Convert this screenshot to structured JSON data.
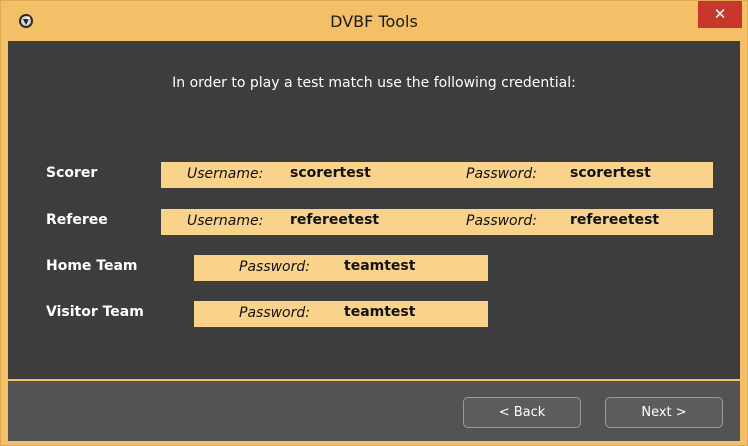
{
  "window": {
    "title": "DVBF Tools",
    "close_label": "✕"
  },
  "intro_text": "In order to play a test match use the following credential:",
  "credentials": {
    "scorer": {
      "label": "Scorer",
      "username_key": "Username:",
      "username": "scorertest",
      "password_key": "Password:",
      "password": "scorertest"
    },
    "referee": {
      "label": "Referee",
      "username_key": "Username:",
      "username": "refereetest",
      "password_key": "Password:",
      "password": "refereetest"
    },
    "home_team": {
      "label": "Home Team",
      "password_key": "Password:",
      "password": "teamtest"
    },
    "visitor_team": {
      "label": "Visitor Team",
      "password_key": "Password:",
      "password": "teamtest"
    }
  },
  "buttons": {
    "back": "< Back",
    "next": "Next >"
  },
  "colors": {
    "title_bar": "#f4c067",
    "close_button": "#c8372d",
    "content_bg": "#3d3d3d",
    "footer_bg": "#535353",
    "credential_box": "#f9d28c"
  },
  "icons": {
    "app": "app-logo-icon",
    "close": "close-icon"
  }
}
